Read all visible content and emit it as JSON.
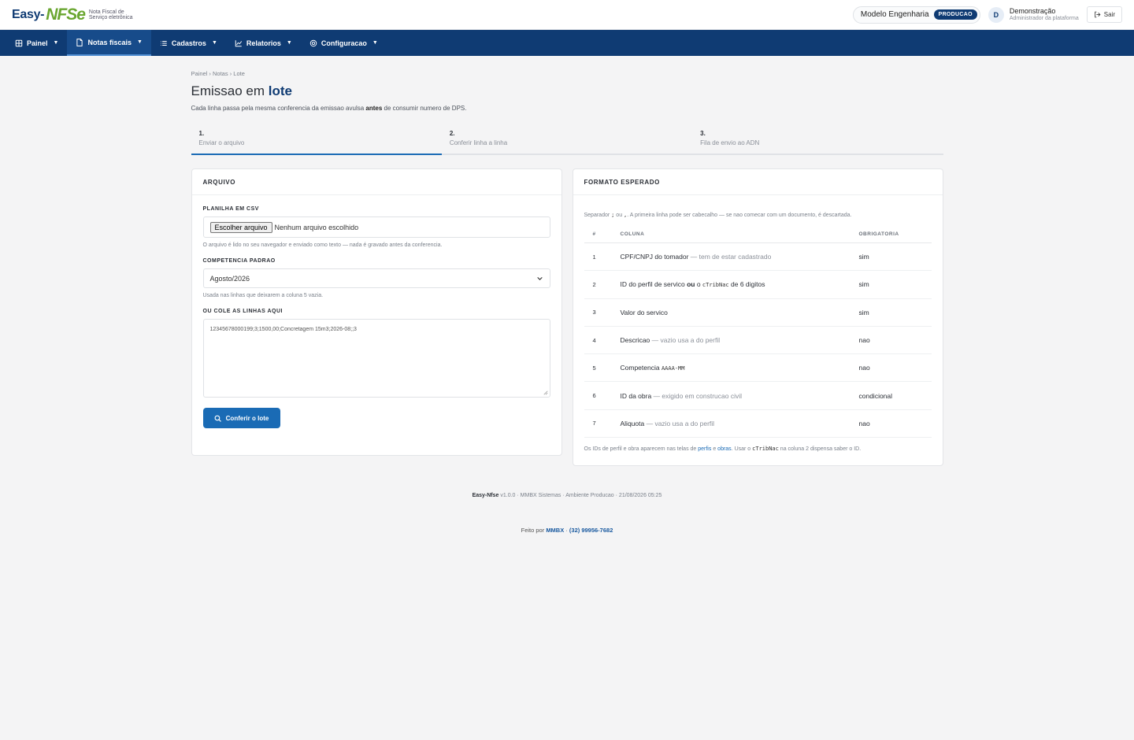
{
  "brand": {
    "easy": "Easy-",
    "nfse": "NFSe",
    "subtitle": "Nota Fiscal de Serviço eletrônica"
  },
  "header": {
    "company": "Modelo Engenharia",
    "env_badge": "PRODUCAO",
    "user_initial": "D",
    "user_name": "Demonstração",
    "user_role": "Administrador da plataforma",
    "logout": "Sair"
  },
  "nav": [
    {
      "label": "Painel",
      "icon": "dashboard-icon",
      "active": false
    },
    {
      "label": "Notas fiscais",
      "icon": "document-icon",
      "active": true
    },
    {
      "label": "Cadastros",
      "icon": "list-icon",
      "active": false
    },
    {
      "label": "Relatorios",
      "icon": "chart-icon",
      "active": false
    },
    {
      "label": "Configuracao",
      "icon": "gear-icon",
      "active": false
    }
  ],
  "breadcrumb": "Painel › Notas › Lote",
  "page": {
    "title_prefix": "Emissao em ",
    "title_bold": "lote",
    "sub_before": "Cada linha passa pela mesma conferencia da emissao avulsa ",
    "sub_bold": "antes",
    "sub_after": " de consumir numero de DPS."
  },
  "steps": [
    {
      "num": "1.",
      "label": "Enviar o arquivo"
    },
    {
      "num": "2.",
      "label": "Conferir linha a linha"
    },
    {
      "num": "3.",
      "label": "Fila de envio ao ADN"
    }
  ],
  "upload": {
    "card_title": "ARQUIVO",
    "csv_label": "PLANILHA EM CSV",
    "file_button": "Escolher arquivo",
    "file_none": "Nenhum arquivo escolhido",
    "csv_hint": "O arquivo é lido no seu navegador e enviado como texto — nada é gravado antes da conferencia.",
    "comp_label": "COMPETENCIA PADRAO",
    "comp_value": "Agosto/2026",
    "comp_hint": "Usada nas linhas que deixarem a coluna 5 vazia.",
    "paste_label": "OU COLE AS LINHAS AQUI",
    "paste_value": "12345678000199;3;1500,00;Concretagem 15m3;2026-08;;3",
    "submit": "Conferir o lote"
  },
  "format": {
    "card_title": "FORMATO ESPERADO",
    "intro_a": "Separador ",
    "sep1": ";",
    "intro_b": " ou ",
    "sep2": ",",
    "intro_c": ". A primeira linha pode ser cabecalho — se nao comecar com um documento, é descartada.",
    "headers": {
      "num": "#",
      "col": "COLUNA",
      "req": "OBRIGATORIA"
    },
    "rows": [
      {
        "n": "1",
        "main": "CPF/CNPJ do tomador",
        "note": " — tem de estar cadastrado",
        "req": "sim"
      },
      {
        "n": "2",
        "main": "ID do perfil de servico ",
        "bold": "ou",
        "after": " o ",
        "code": "cTribNac",
        "after2": " de 6 digitos",
        "req": "sim"
      },
      {
        "n": "3",
        "main": "Valor do servico",
        "req": "sim"
      },
      {
        "n": "4",
        "main": "Descricao",
        "note": " — vazio usa a do perfil",
        "req": "nao"
      },
      {
        "n": "5",
        "main": "Competencia ",
        "code": "AAAA-MM",
        "req": "nao"
      },
      {
        "n": "6",
        "main": "ID da obra",
        "note": " — exigido em construcao civil",
        "req": "condicional"
      },
      {
        "n": "7",
        "main": "Aliquota",
        "note": " — vazio usa a do perfil",
        "req": "nao"
      }
    ],
    "foot_a": "Os IDs de perfil e obra aparecem nas telas de ",
    "foot_link1": "perfis",
    "foot_b": " e ",
    "foot_link2": "obras",
    "foot_c": ". Usar o ",
    "foot_code": "cTribNac",
    "foot_d": " na coluna 2 dispensa saber o ID."
  },
  "footer": {
    "app": "Easy-Nfse",
    "meta": " v1.0.0 · MMBX Sistemas · Ambiente Producao · 21/08/2026 05:25",
    "made_by": "Feito por ",
    "company": "MMBX",
    "sep": " · ",
    "phone": "(32) 99956-7682"
  },
  "colors": {
    "primary": "#0f3b73",
    "accent": "#1a6bb5",
    "brand_green": "#6aa630"
  }
}
